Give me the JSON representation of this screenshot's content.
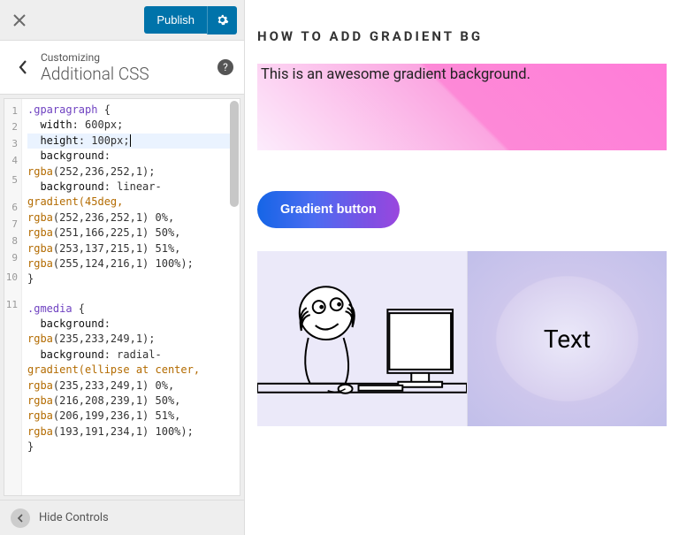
{
  "topbar": {
    "publish_label": "Publish"
  },
  "header": {
    "sub": "Customizing",
    "title": "Additional CSS"
  },
  "footer": {
    "hide_label": "Hide Controls"
  },
  "editor": {
    "gutters": [
      "1",
      "2",
      "3",
      "4",
      "",
      "5",
      "",
      "",
      "",
      "",
      "6",
      "7",
      "8",
      "9",
      "",
      "10",
      "",
      "",
      "",
      "",
      "11"
    ],
    "code_lines": [
      {
        "sel": ".gparagraph",
        "rest": " {"
      },
      {
        "indent": "  ",
        "prop": "width",
        "val": " 600px;"
      },
      {
        "indent": "  ",
        "prop": "height",
        "val": " 100px;",
        "hl": true,
        "caret": true
      },
      {
        "indent": "  ",
        "prop": "background",
        "val": ""
      },
      {
        "fn": "rgba",
        "args": "(252,236,252,1);"
      },
      {
        "indent": "  ",
        "prop": "background",
        "val": " linear-"
      },
      {
        "fnline": "gradient(45deg,"
      },
      {
        "fn": "rgba",
        "args": "(252,236,252,1) 0%,"
      },
      {
        "fn": "rgba",
        "args": "(251,166,225,1) 50%,"
      },
      {
        "fn": "rgba",
        "args": "(253,137,215,1) 51%,"
      },
      {
        "fn": "rgba",
        "args": "(255,124,216,1) 100%);"
      },
      {
        "plain": "}"
      },
      {
        "plain": ""
      },
      {
        "sel": ".gmedia",
        "rest": " {"
      },
      {
        "indent": "  ",
        "prop": "background",
        "val": ""
      },
      {
        "fn": "rgba",
        "args": "(235,233,249,1);"
      },
      {
        "indent": "  ",
        "prop": "background",
        "val": " radial-"
      },
      {
        "fnline": "gradient(ellipse at center,"
      },
      {
        "fn": "rgba",
        "args": "(235,233,249,1) 0%,"
      },
      {
        "fn": "rgba",
        "args": "(216,208,239,1) 50%,"
      },
      {
        "fn": "rgba",
        "args": "(206,199,236,1) 51%,"
      },
      {
        "fn": "rgba",
        "args": "(193,191,234,1) 100%);"
      },
      {
        "plain": "}"
      }
    ]
  },
  "preview": {
    "heading": "HOW TO ADD GRADIENT BG",
    "paragraph_text": "This is an awesome gradient background.",
    "button_label": "Gradient button",
    "media_text": "Text"
  }
}
